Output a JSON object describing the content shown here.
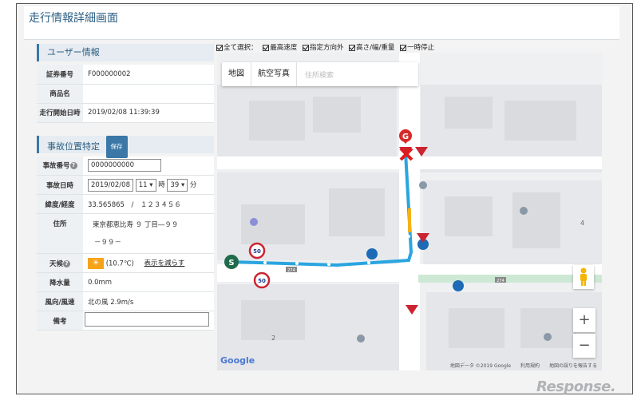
{
  "page": {
    "title": "走行情報詳細画面"
  },
  "user_info": {
    "section_title": "ユーザー情報",
    "rows": [
      {
        "label": "証券番号",
        "value": "F000000002"
      },
      {
        "label": "商品名",
        "value": ""
      },
      {
        "label": "走行開始日時",
        "value": "2019/02/08 11:39:39"
      }
    ]
  },
  "accident": {
    "section_title": "事故位置特定",
    "save_label": "保存",
    "number_label": "事故番号",
    "number_value": "0000000000",
    "datetime_label": "事故日時",
    "date_value": "2019/02/08",
    "hour_value": "11",
    "hour_unit": "時",
    "minute_value": "39",
    "minute_unit": "分",
    "latlng_label": "緯度/経度",
    "latlng_value": "33.565865　/　１２３４５６",
    "address_label": "住所",
    "address_line1": "東京都恵比寿 ９ 丁目―９９",
    "address_line2": "－９９－",
    "weather_label": "天候",
    "weather_temp": "(10.7℃)",
    "weather_link": "表示を減らす",
    "rain_label": "降水量",
    "rain_value": "0.0mm",
    "wind_label": "風向/風速",
    "wind_value": "北の風 2.9m/s",
    "note_label": "備考",
    "note_value": ""
  },
  "filters": {
    "items": [
      {
        "label": "全て選択："
      },
      {
        "label": "最高速度"
      },
      {
        "label": "指定方向外"
      },
      {
        "label": "高さ/幅/重量"
      },
      {
        "label": "一時停止"
      }
    ]
  },
  "map": {
    "tab_map": "地図",
    "tab_satellite": "航空写真",
    "search_placeholder": "住所検索",
    "start_marker": "S",
    "goal_marker": "G",
    "speed_sign_1": "50",
    "speed_sign_2": "50",
    "route_label_1": "274",
    "route_label_2": "274",
    "block_num_4": "4",
    "block_num_2": "2",
    "google_label": "Google",
    "footer_data": "地図データ ©2019 Google",
    "footer_terms": "利用規約",
    "footer_report": "地図の誤りを報告する"
  },
  "watermark": "Response."
}
